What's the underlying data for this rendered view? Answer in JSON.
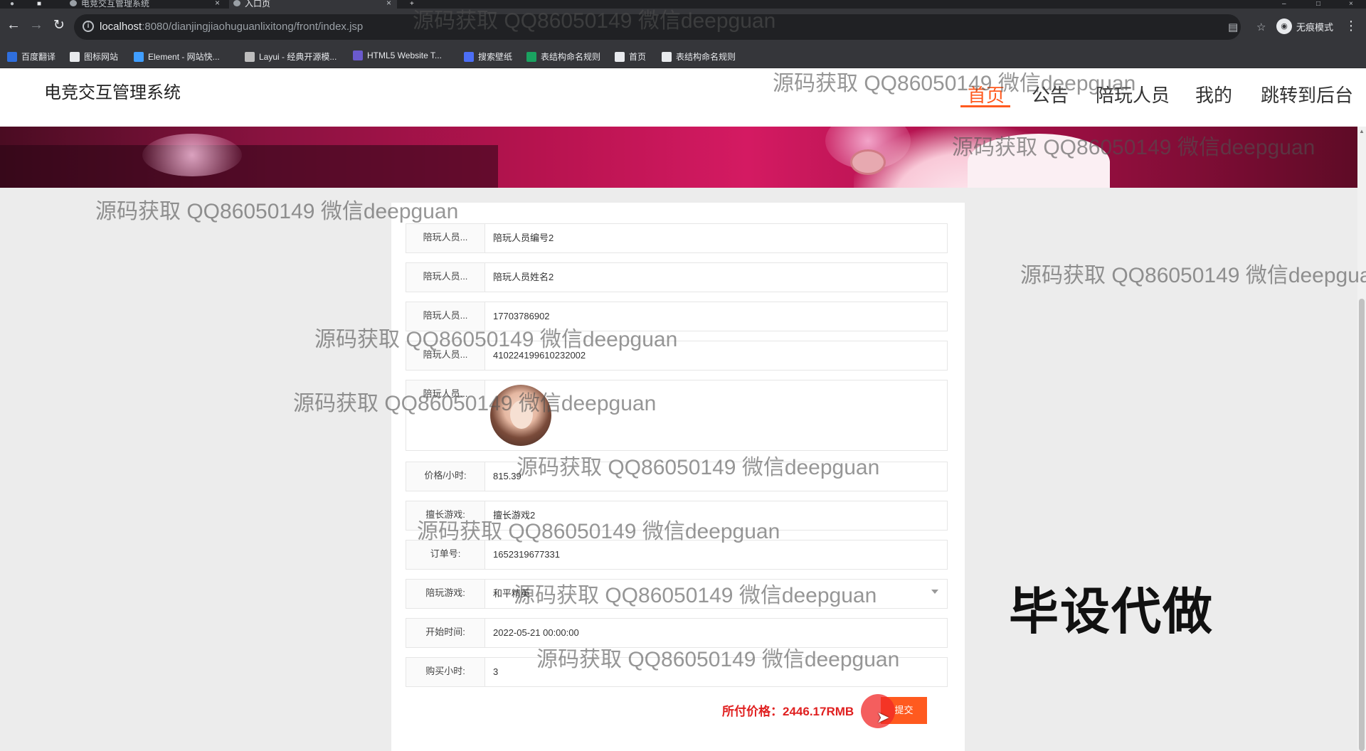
{
  "browser": {
    "tabs": [
      {
        "label": "电竞交互管理系统",
        "active": false
      },
      {
        "label": "入口页",
        "active": true
      }
    ],
    "new_tab_glyph": "+",
    "close_glyph": "×",
    "url_host": "localhost",
    "url_rest": ":8080/dianjingjiaohuguanlixitong/front/index.jsp",
    "profile_label": "无痕模式",
    "bookmarks": [
      {
        "label": "百度翻译",
        "color": "#2f6fde"
      },
      {
        "label": "图标网站",
        "color": "#e8eaed"
      },
      {
        "label": "Element - 网站快...",
        "color": "#409eff"
      },
      {
        "label": "Layui - 经典开源模...",
        "color": "#bdbdbd"
      },
      {
        "label": "HTML5 Website T...",
        "color": "#6a5acd"
      },
      {
        "label": "搜索壁纸",
        "color": "#4c6ef5"
      },
      {
        "label": "表结构命名规则",
        "color": "#1aa260"
      },
      {
        "label": "首页",
        "color": "#e8eaed"
      },
      {
        "label": "表结构命名规则",
        "color": "#e8eaed"
      }
    ]
  },
  "site": {
    "title": "电竞交互管理系统",
    "nav": [
      {
        "label": "首页",
        "active": true
      },
      {
        "label": "公告",
        "active": false
      },
      {
        "label": "陪玩人员",
        "active": false
      },
      {
        "label": "我的",
        "active": false
      },
      {
        "label": "跳转到后台",
        "active": false
      }
    ],
    "accent_color": "#ff5a1f"
  },
  "form": {
    "rows": [
      {
        "label": "陪玩人员...",
        "value": "陪玩人员编号2"
      },
      {
        "label": "陪玩人员...",
        "value": "陪玩人员姓名2"
      },
      {
        "label": "陪玩人员...",
        "value": "17703786902"
      },
      {
        "label": "陪玩人员...",
        "value": "410224199610232002"
      },
      {
        "label": "陪玩人员...",
        "value": ""
      },
      {
        "label": "价格/小时:",
        "value": "815.39"
      },
      {
        "label": "擅长游戏:",
        "value": "擅长游戏2"
      },
      {
        "label": "订单号:",
        "value": "1652319677331"
      },
      {
        "label": "陪玩游戏:",
        "value": "和平精英"
      },
      {
        "label": "开始时间:",
        "value": "2022-05-21 00:00:00"
      },
      {
        "label": "购买小时:",
        "value": "3"
      }
    ],
    "total_text": "所付价格：2446.17RMB",
    "submit_label": "提交"
  },
  "overlay": {
    "promo_text": "毕设代做",
    "watermark": "源码获取 QQ86050149 微信deepguan"
  }
}
